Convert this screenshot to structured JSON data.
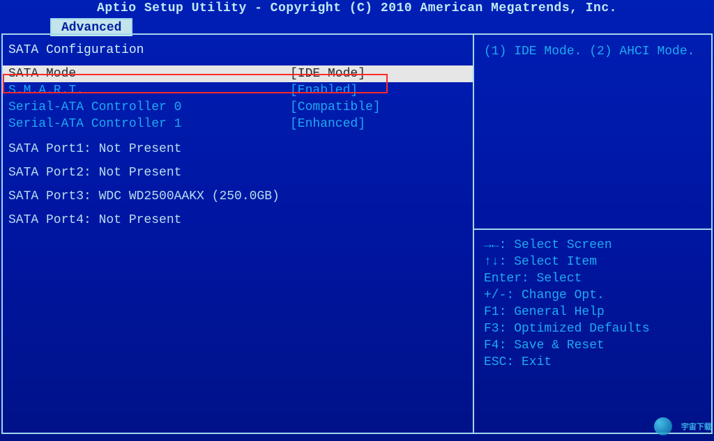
{
  "title": "Aptio Setup Utility - Copyright (C) 2010 American Megatrends, Inc.",
  "tab": {
    "label": "Advanced"
  },
  "main": {
    "section_title": "SATA Configuration",
    "rows": [
      {
        "label": "SATA Mode",
        "value": "[IDE Mode]",
        "selected": true
      },
      {
        "label": "S.M.A.R.T.",
        "value": "[Enabled]",
        "selected": false
      },
      {
        "label": "Serial-ATA Controller 0",
        "value": "[Compatible]",
        "selected": false
      },
      {
        "label": "Serial-ATA Controller 1",
        "value": "[Enhanced]",
        "selected": false
      }
    ],
    "ports": [
      "SATA Port1: Not Present",
      "SATA Port2: Not Present",
      "SATA Port3: WDC WD2500AAKX (250.0GB)",
      "SATA Port4: Not Present"
    ]
  },
  "help": {
    "text": "(1) IDE Mode. (2) AHCI Mode."
  },
  "hotkeys": {
    "select_screen": "Select Screen",
    "select_item": "Select Item",
    "enter": "Enter: Select",
    "change": "+/-: Change Opt.",
    "f1": "F1: General Help",
    "f3": "F3: Optimized Defaults",
    "f4": "F4: Save & Reset",
    "esc": "ESC: Exit"
  },
  "watermark": "宇宙下载"
}
